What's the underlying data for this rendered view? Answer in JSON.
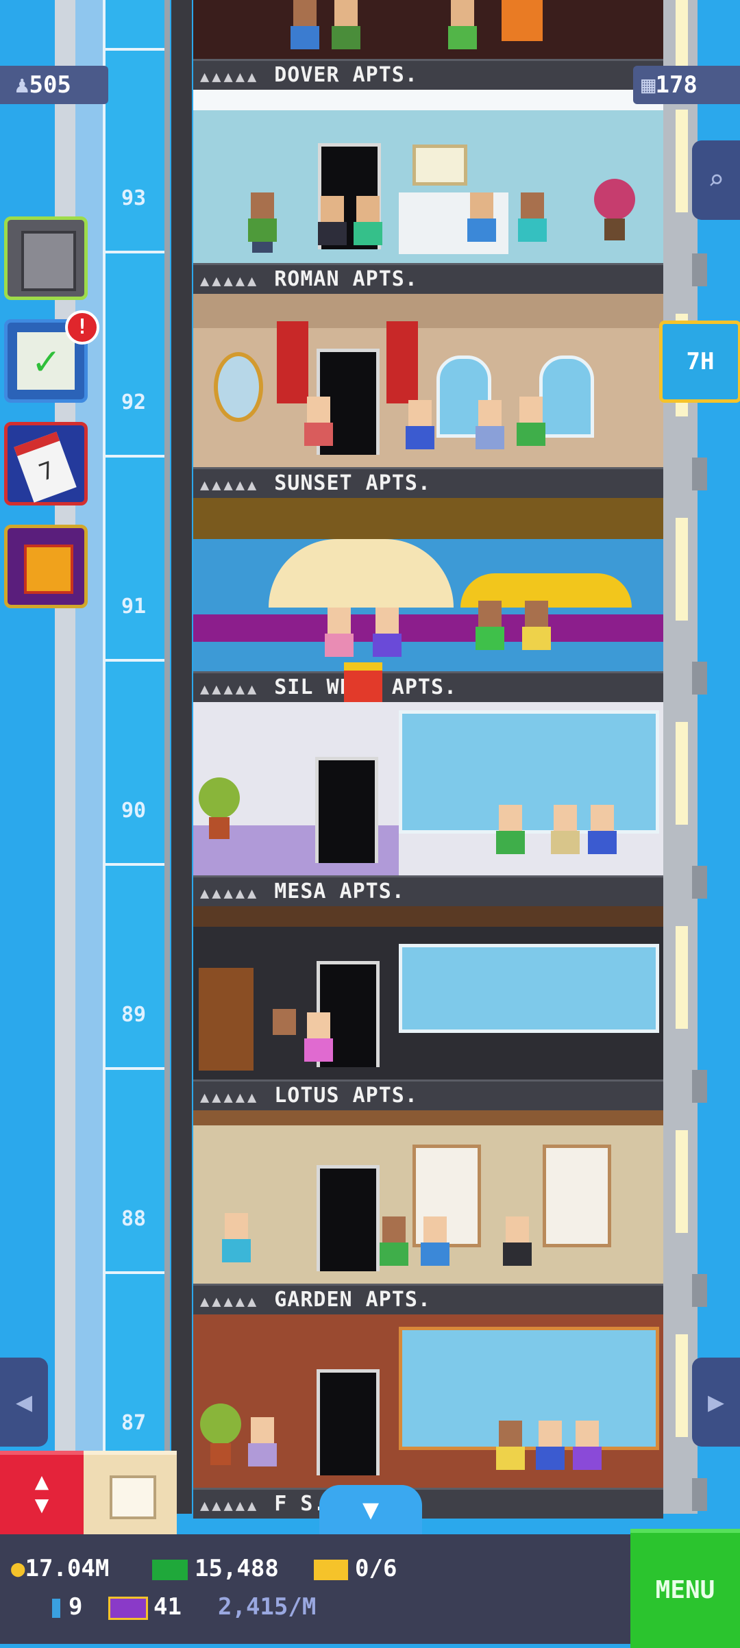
{
  "hud": {
    "population": "505",
    "floors": "178",
    "timer": "7H"
  },
  "floors": [
    {
      "number": "",
      "name": "DOVER APTS."
    },
    {
      "number": "93",
      "name": "ROMAN APTS."
    },
    {
      "number": "92",
      "name": "SUNSET APTS."
    },
    {
      "number": "91",
      "name": "SIL    WELL APTS."
    },
    {
      "number": "90",
      "name": "MESA APTS."
    },
    {
      "number": "89",
      "name": "LOTUS APTS."
    },
    {
      "number": "88",
      "name": "GARDEN APTS."
    },
    {
      "number": "87",
      "name": "F          S."
    }
  ],
  "currency": {
    "coins": "17.04M",
    "bux": "15,488",
    "tickets": "0/6",
    "keys": "9",
    "vip": "41",
    "rate": "2,415/M"
  },
  "menu_label": "MENU",
  "icons": {
    "population": "person-icon",
    "floors": "building-icon",
    "search": "magnifier-icon",
    "tasks": "checklist-icon",
    "calendar": "calendar-icon",
    "gift": "gift-icon",
    "elevator": "elevator-arrows-icon",
    "build": "box-icon"
  },
  "colors": {
    "sky": "#2ba8ec",
    "hud_panel": "#4b5a8a",
    "menu_green": "#2bc42e",
    "elevator_red": "#e4233a"
  }
}
